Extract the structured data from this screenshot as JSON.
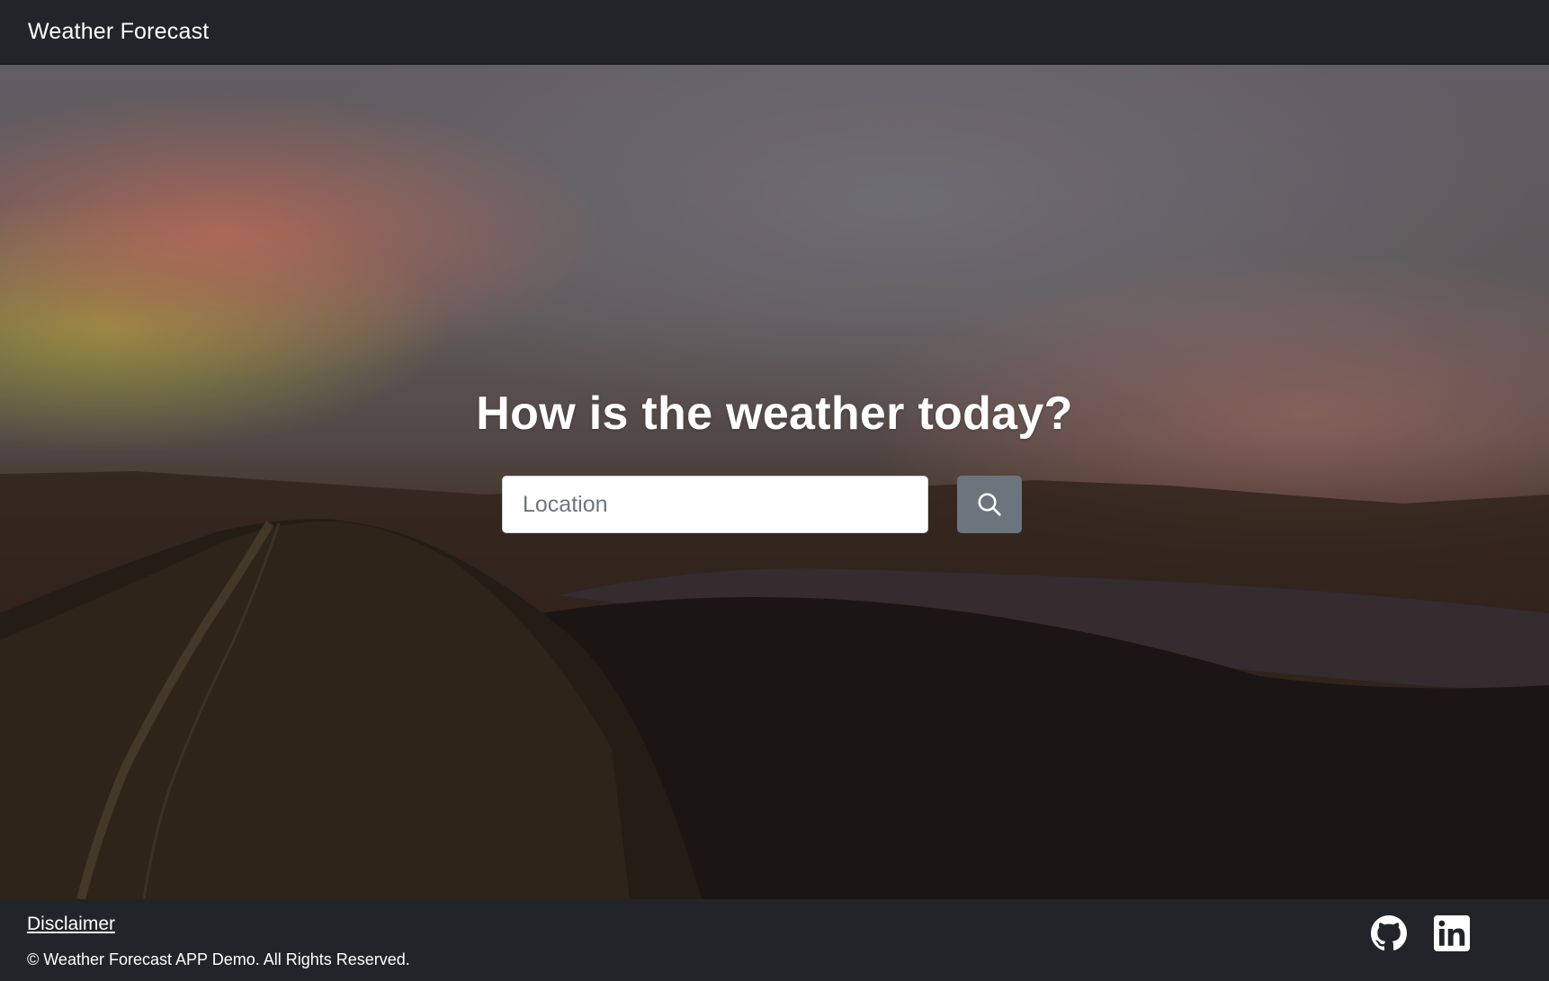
{
  "navbar": {
    "brand": "Weather Forecast"
  },
  "hero": {
    "title": "How is the weather today?",
    "search": {
      "placeholder": "Location",
      "value": "",
      "button_icon": "search-icon"
    }
  },
  "footer": {
    "disclaimer_label": "Disclaimer",
    "copyright": "© Weather Forecast APP Demo. All Rights Reserved.",
    "social": [
      {
        "icon": "github-icon"
      },
      {
        "icon": "linkedin-icon"
      }
    ]
  },
  "colors": {
    "navbar_bg": "#212529",
    "footer_bg": "#212529",
    "button_bg": "#6c757d",
    "text": "#ffffff"
  }
}
